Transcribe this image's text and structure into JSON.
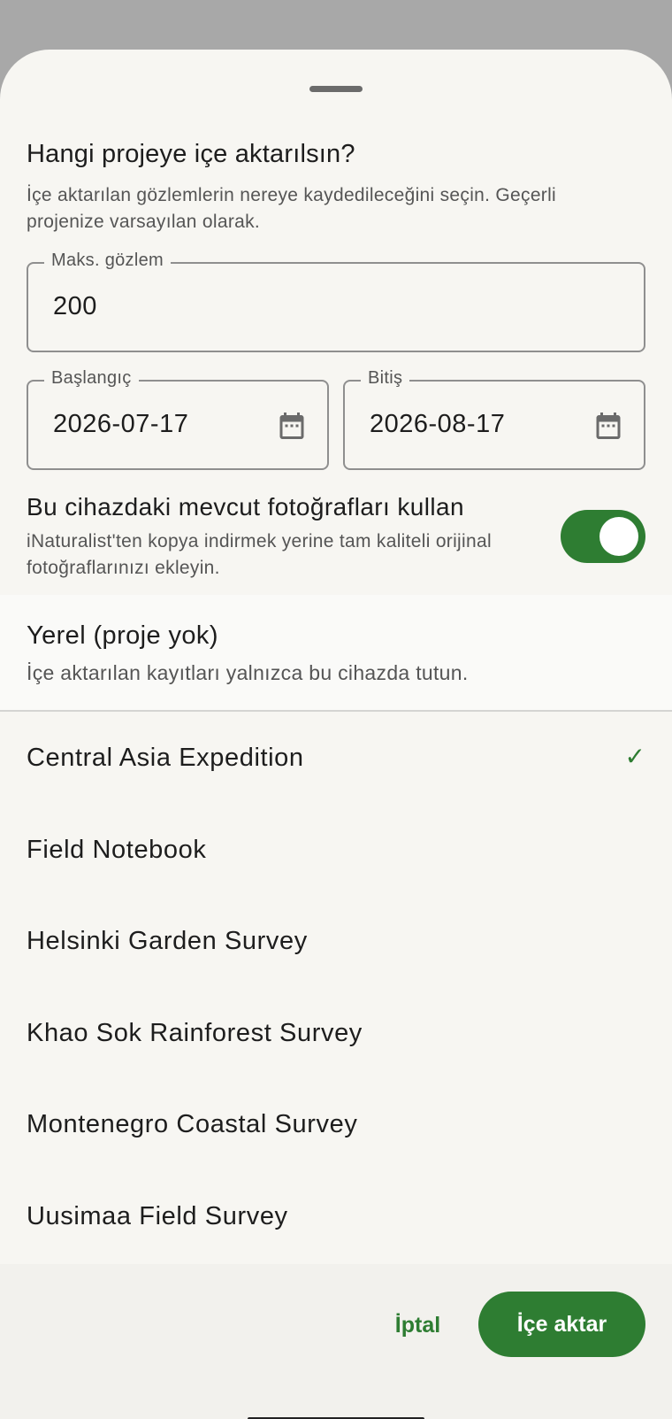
{
  "sheet": {
    "title": "Hangi projeye içe aktarılsın?",
    "subtitle": "İçe aktarılan gözlemlerin nereye kaydedileceğini seçin. Geçerli projenize varsayılan olarak."
  },
  "form": {
    "max_observations": {
      "label": "Maks. gözlem",
      "value": "200"
    },
    "start_date": {
      "label": "Başlangıç",
      "value": "2026-07-17",
      "icon": "calendar-icon"
    },
    "end_date": {
      "label": "Bitiş",
      "value": "2026-08-17",
      "icon": "calendar-icon"
    },
    "use_device_photos": {
      "title": "Bu cihazdaki mevcut fotoğrafları kullan",
      "description": "iNaturalist'ten kopya indirmek yerine tam kaliteli orijinal fotoğraflarınızı ekleyin.",
      "enabled": true
    }
  },
  "local_option": {
    "title": "Yerel (proje yok)",
    "description": "İçe aktarılan kayıtları yalnızca bu cihazda tutun."
  },
  "projects": [
    {
      "label": "Central Asia Expedition",
      "selected": true,
      "check": "✓"
    },
    {
      "label": "Field Notebook",
      "selected": false,
      "check": ""
    },
    {
      "label": "Helsinki Garden Survey",
      "selected": false,
      "check": ""
    },
    {
      "label": "Khao Sok Rainforest Survey",
      "selected": false,
      "check": ""
    },
    {
      "label": "Montenegro Coastal Survey",
      "selected": false,
      "check": ""
    },
    {
      "label": "Uusimaa Field Survey",
      "selected": false,
      "check": ""
    }
  ],
  "actions": {
    "cancel_label": "İptal",
    "import_label": "İçe aktar"
  },
  "colors": {
    "accent": "#2e7d32",
    "sheet_background": "#f7f6f2",
    "scrim": "#a8a8a8"
  }
}
